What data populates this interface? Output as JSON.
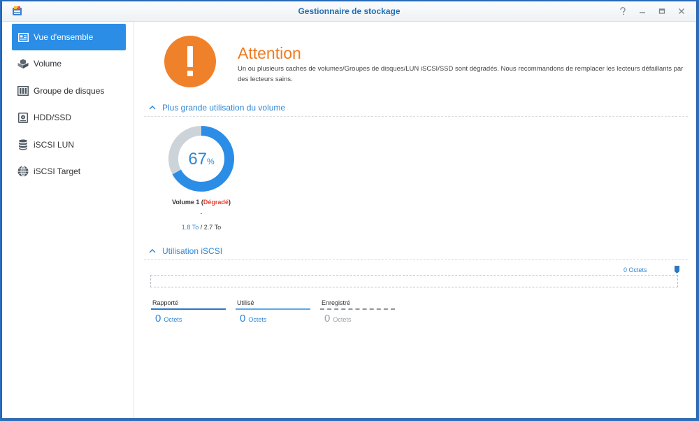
{
  "window": {
    "title": "Gestionnaire de stockage",
    "controls": [
      "help",
      "minimize",
      "maximize",
      "close"
    ]
  },
  "sidebar": {
    "items": [
      {
        "label": "Vue d'ensemble",
        "icon": "overview-icon",
        "active": true
      },
      {
        "label": "Volume",
        "icon": "volume-icon",
        "active": false
      },
      {
        "label": "Groupe de disques",
        "icon": "disk-group-icon",
        "active": false
      },
      {
        "label": "HDD/SSD",
        "icon": "hdd-icon",
        "active": false
      },
      {
        "label": "iSCSI LUN",
        "icon": "database-icon",
        "active": false
      },
      {
        "label": "iSCSI Target",
        "icon": "globe-icon",
        "active": false
      }
    ]
  },
  "alert": {
    "icon_glyph": "!",
    "title": "Attention",
    "message": "Un ou plusieurs caches de volumes/Groupes de disques/LUN iSCSI/SSD sont dégradés. Nous recommandons de remplacer les lecteurs défaillants par des lecteurs sains.",
    "color": "#f0812b"
  },
  "volume_usage": {
    "section_title": "Plus grande utilisation du volume",
    "percent": 67,
    "percent_value": "67",
    "percent_unit": "%",
    "volume_name": "Volume 1",
    "status": "Dégradé",
    "dash": "-",
    "used": "1.8 To",
    "separator": " / ",
    "total": "2.7 To",
    "colors": {
      "used": "#2b8de6",
      "free": "#ccd4da"
    }
  },
  "iscsi": {
    "section_title": "Utilisation iSCSI",
    "total_label": "0 Octets",
    "legend": [
      {
        "label": "Rapporté",
        "value": "0",
        "unit": "Octets"
      },
      {
        "label": "Utilisé",
        "value": "0",
        "unit": "Octets"
      },
      {
        "label": "Enregistré",
        "value": "0",
        "unit": "Octets"
      }
    ]
  }
}
